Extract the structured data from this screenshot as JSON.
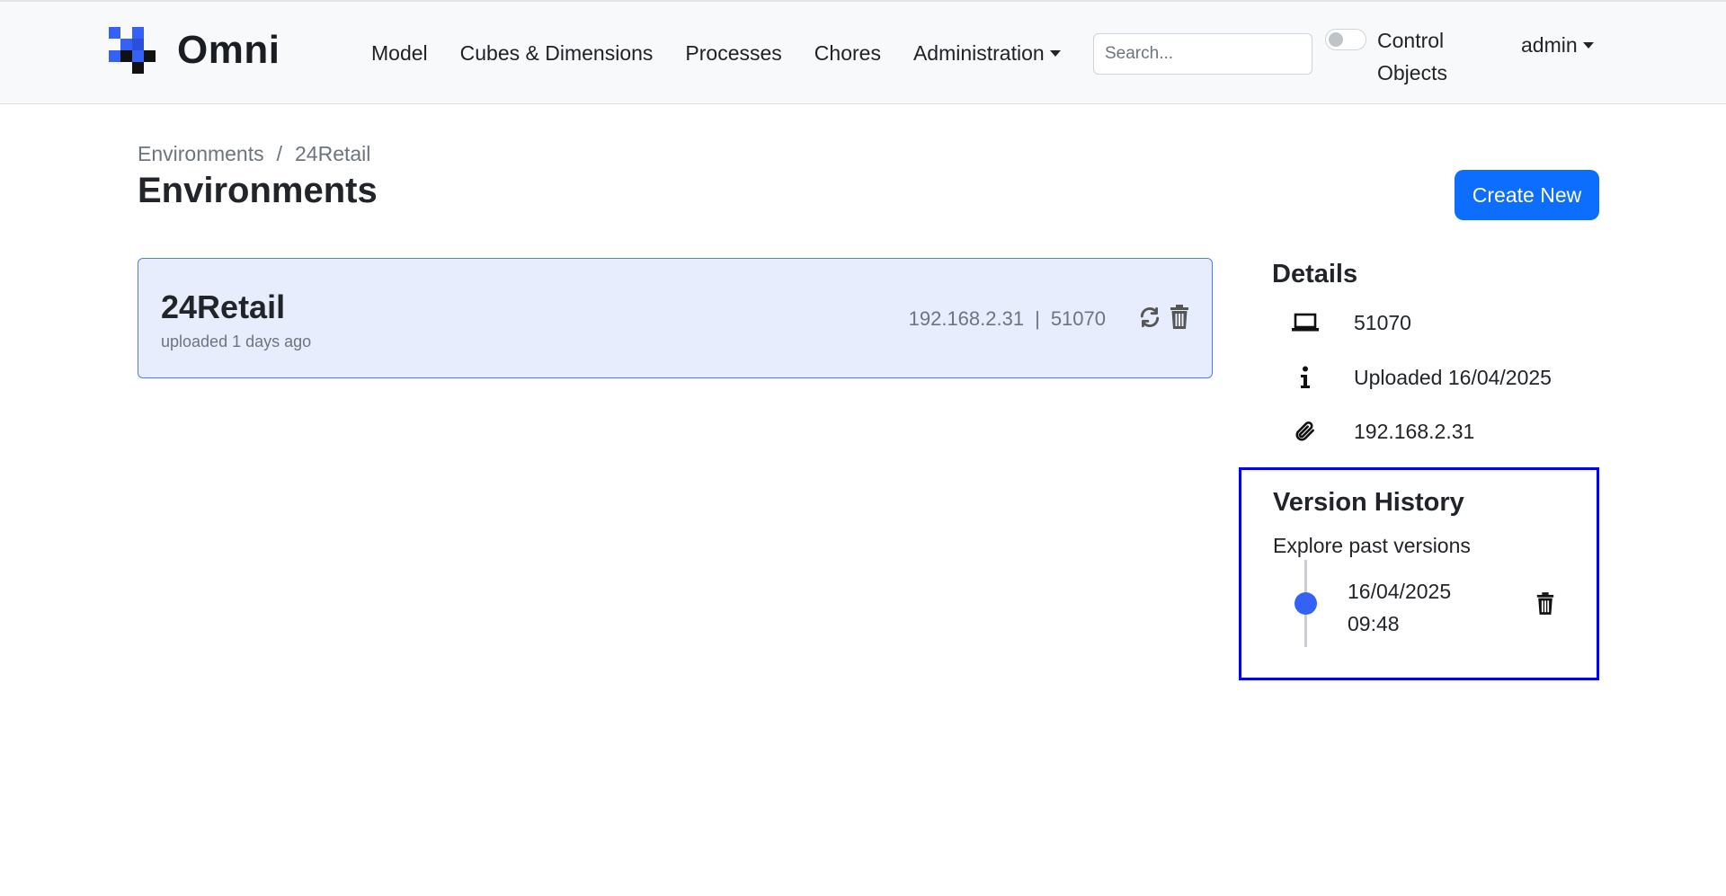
{
  "navbar": {
    "brand_name": "Omni",
    "links": [
      "Model",
      "Cubes & Dimensions",
      "Processes",
      "Chores",
      "Administration"
    ],
    "search_placeholder": "Search...",
    "toggle_label": "Control Objects",
    "toggle_on": false,
    "user": "admin"
  },
  "breadcrumb": {
    "parent": "Environments",
    "separator": "/",
    "current": "24Retail"
  },
  "page": {
    "title": "Environments",
    "create_button": "Create New"
  },
  "environments": [
    {
      "name": "24Retail",
      "uploaded": "uploaded 1 days ago",
      "host": "192.168.2.31",
      "separator": "|",
      "port": "51070"
    }
  ],
  "details": {
    "title": "Details",
    "port": "51070",
    "uploaded": "Uploaded 16/04/2025",
    "host": "192.168.2.31"
  },
  "version_history": {
    "title": "Version History",
    "subtitle": "Explore past versions",
    "versions": [
      {
        "date": "16/04/2025",
        "time": "09:48"
      }
    ]
  },
  "colors": {
    "primary": "#0d6efd",
    "card_bg": "#e8edfd",
    "card_border": "#4d7ef7",
    "timeline_dot": "#3461f6",
    "highlight_box": "#0000ff"
  },
  "icons": [
    "omni-logo-icon",
    "refresh-icon",
    "trash-icon",
    "laptop-icon",
    "info-icon",
    "paperclip-icon"
  ]
}
